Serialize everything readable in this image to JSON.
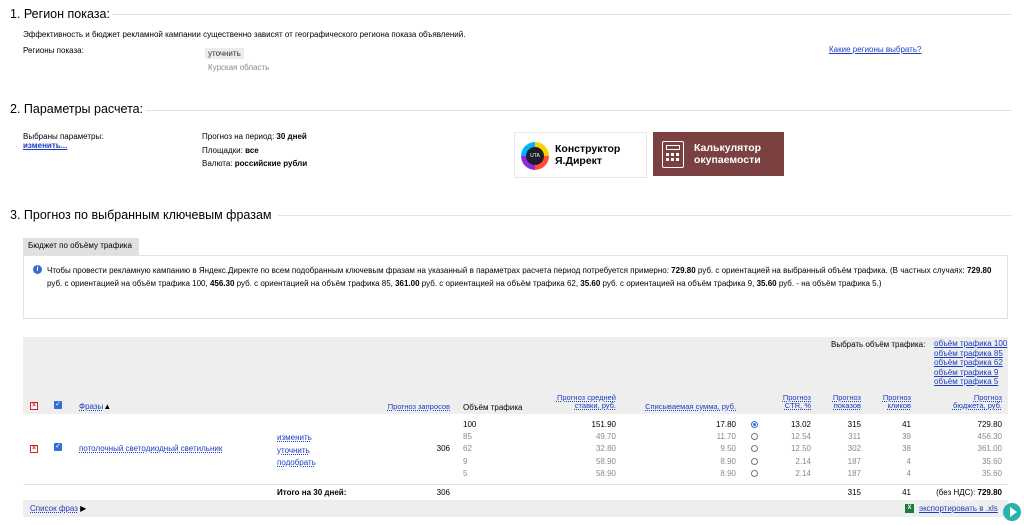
{
  "section1": {
    "title": "1. Регион показа:",
    "description": "Эффективность и бюджет рекламной кампании существенно зависят от географического региона показа объявлений.",
    "regions_label": "Регионы показа:",
    "refine_label": "уточнить",
    "region_value": "Курская область",
    "which_regions_link": "Какие регионы выбрать?"
  },
  "section2": {
    "title": "2. Параметры расчета:",
    "selected_label": "Выбраны параметры:",
    "change_link": "изменить...",
    "period_label": "Прогноз на период:",
    "period_value": "30 дней",
    "sites_label": "Площадки:",
    "sites_value": "все",
    "currency_label": "Валюта:",
    "currency_value": "российские рубли",
    "promo_constructor_line1": "Конструктор",
    "promo_constructor_line2": "Я.Директ",
    "promo_constructor_logo": "UTA",
    "promo_calc_line1": "Калькулятор",
    "promo_calc_line2": "окупаемости"
  },
  "section3": {
    "title": "3. Прогноз по выбранным ключевым фразам",
    "tab_label": "Бюджет по объёму трафика",
    "info": {
      "p1": "Чтобы провести рекламную кампанию в Яндекс.Директе по всем подобранным ключевым фразам на указанный в параметрах расчета период потребуется примерно: ",
      "v1": "729.80",
      "p2": " руб. с ориентацией на выбранный объём трафика. (В частных случаях: ",
      "v2": "729.80",
      "p3": " руб. с ориентацией на объём трафика 100, ",
      "v3": "456.30",
      "p4": " руб. с ориентацией на объём трафика 85, ",
      "v4": "361.00",
      "p5": " руб. с ориентацией на объём трафика 62, ",
      "v5": "35.60",
      "p6": " руб. с ориентацией на объём трафика 9, ",
      "v6": "35.60",
      "p7": " руб. - на объём трафика 5.)"
    },
    "select_traffic_label": "Выбрать объём трафика:",
    "traffic_links": [
      "объём трафика 100",
      "объём трафика 85",
      "объём трафика 62",
      "объём трафика 9",
      "объём трафика 5"
    ],
    "columns": {
      "phrases": "Фразы",
      "sort_arrow": "▲",
      "requests": "Прогноз запросов",
      "traffic": "Объём трафика",
      "avg_bid_1": "Прогноз средней",
      "avg_bid_2": "ставки, руб.",
      "charged": "Списываемая сумма, руб.",
      "ctr_1": "Прогноз",
      "ctr_2": "CTR, %",
      "shows_1": "Прогноз",
      "shows_2": "показов",
      "clicks_1": "Прогноз",
      "clicks_2": "кликов",
      "budget_1": "Прогноз",
      "budget_2": "бюджета, руб."
    },
    "row": {
      "phrase": "потолочный светодиодный светильник",
      "action_change": "изменить",
      "action_refine": "уточнить",
      "action_pick": "подобрать",
      "requests": "306",
      "sub": [
        {
          "traffic": "100",
          "bid": "151.90",
          "charged": "17.80",
          "ctr": "13.02",
          "shows": "315",
          "clicks": "41",
          "budget": "729.80",
          "selected": true
        },
        {
          "traffic": "85",
          "bid": "49.70",
          "charged": "11.70",
          "ctr": "12.54",
          "shows": "311",
          "clicks": "39",
          "budget": "456.30",
          "selected": false
        },
        {
          "traffic": "62",
          "bid": "32.80",
          "charged": "9.50",
          "ctr": "12.50",
          "shows": "302",
          "clicks": "38",
          "budget": "361.00",
          "selected": false
        },
        {
          "traffic": "9",
          "bid": "58.90",
          "charged": "8.90",
          "ctr": "2.14",
          "shows": "187",
          "clicks": "4",
          "budget": "35.60",
          "selected": false
        },
        {
          "traffic": "5",
          "bid": "58.90",
          "charged": "8.90",
          "ctr": "2.14",
          "shows": "187",
          "clicks": "4",
          "budget": "35.60",
          "selected": false
        }
      ]
    },
    "total": {
      "label": "Итого на 30 дней:",
      "requests": "306",
      "shows": "315",
      "clicks": "41",
      "budget_prefix": "(без НДС): ",
      "budget": "729.80"
    },
    "phrase_list_label": "Список фраз",
    "phrase_list_arrow": "▶",
    "export_label": "экспортировать в .xls",
    "xls_icon_text": "X"
  },
  "colors": {
    "link": "#1a3dc1",
    "promo_calc_bg": "#7a4140",
    "checkbox": "#2f6fd6",
    "delete": "#cc2222"
  }
}
